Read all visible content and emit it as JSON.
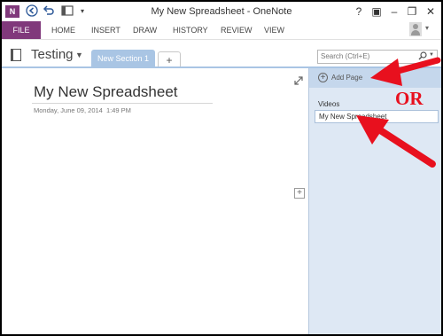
{
  "window": {
    "title": "My New Spreadsheet - OneNote"
  },
  "quick_access": {
    "logo_text": "N"
  },
  "window_buttons": {
    "help": "?",
    "ribbon_opts": "▣",
    "minimize": "–",
    "restore": "❐",
    "close": "✕"
  },
  "ribbon": {
    "file": "FILE",
    "tabs": [
      "HOME",
      "INSERT",
      "DRAW",
      "HISTORY",
      "REVIEW",
      "VIEW"
    ]
  },
  "notebook": {
    "name": "Testing"
  },
  "section_tab": {
    "label": "New Section 1",
    "add_label": "+"
  },
  "search": {
    "placeholder": "Search (Ctrl+E)"
  },
  "page": {
    "title": "My New Spreadsheet",
    "date": "Monday, June 09, 2014",
    "time": "1:49 PM"
  },
  "page_list": {
    "add_page_label": "Add Page",
    "section_heading": "Videos",
    "pages": [
      "My New Spreadsheet"
    ]
  },
  "annotation": {
    "or_text": "OR",
    "color": "#e8101e"
  },
  "colors": {
    "accent": "#80397b",
    "section_tab": "#a9c5e4",
    "pane": "#dee8f4"
  }
}
